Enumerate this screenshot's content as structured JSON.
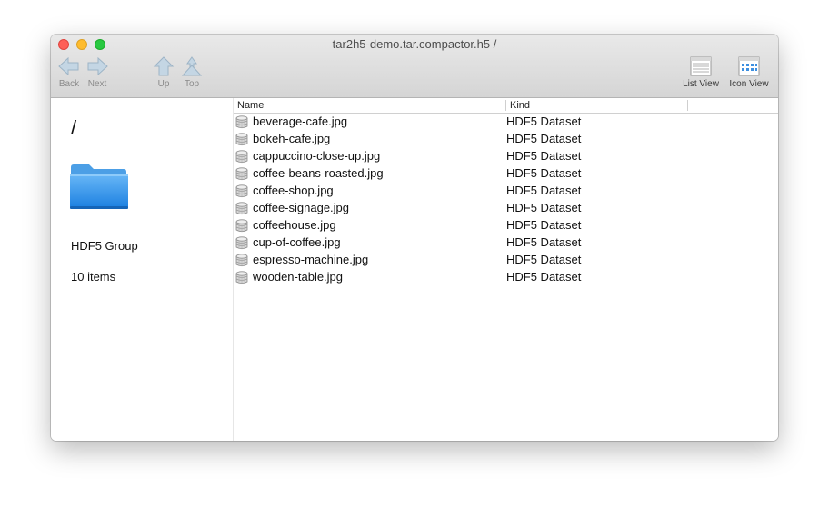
{
  "window": {
    "title": "tar2h5-demo.tar.compactor.h5 /"
  },
  "toolbar": {
    "back_label": "Back",
    "next_label": "Next",
    "up_label": "Up",
    "top_label": "Top",
    "list_view_label": "List View",
    "icon_view_label": "Icon View"
  },
  "sidebar": {
    "path": "/",
    "icon": "folder-icon",
    "kind": "HDF5 Group",
    "count": "10 items"
  },
  "list": {
    "columns": [
      "Name",
      "Kind"
    ],
    "rows": [
      {
        "name": "beverage-cafe.jpg",
        "kind": "HDF5 Dataset"
      },
      {
        "name": "bokeh-cafe.jpg",
        "kind": "HDF5 Dataset"
      },
      {
        "name": "cappuccino-close-up.jpg",
        "kind": "HDF5 Dataset"
      },
      {
        "name": "coffee-beans-roasted.jpg",
        "kind": "HDF5 Dataset"
      },
      {
        "name": "coffee-shop.jpg",
        "kind": "HDF5 Dataset"
      },
      {
        "name": "coffee-signage.jpg",
        "kind": "HDF5 Dataset"
      },
      {
        "name": "coffeehouse.jpg",
        "kind": "HDF5 Dataset"
      },
      {
        "name": "cup-of-coffee.jpg",
        "kind": "HDF5 Dataset"
      },
      {
        "name": "espresso-machine.jpg",
        "kind": "HDF5 Dataset"
      },
      {
        "name": "wooden-table.jpg",
        "kind": "HDF5 Dataset"
      }
    ]
  },
  "colors": {
    "folder": "#3d9cf0",
    "traffic_close": "#fe5f57",
    "traffic_min": "#febc2e",
    "traffic_max": "#28c840"
  }
}
